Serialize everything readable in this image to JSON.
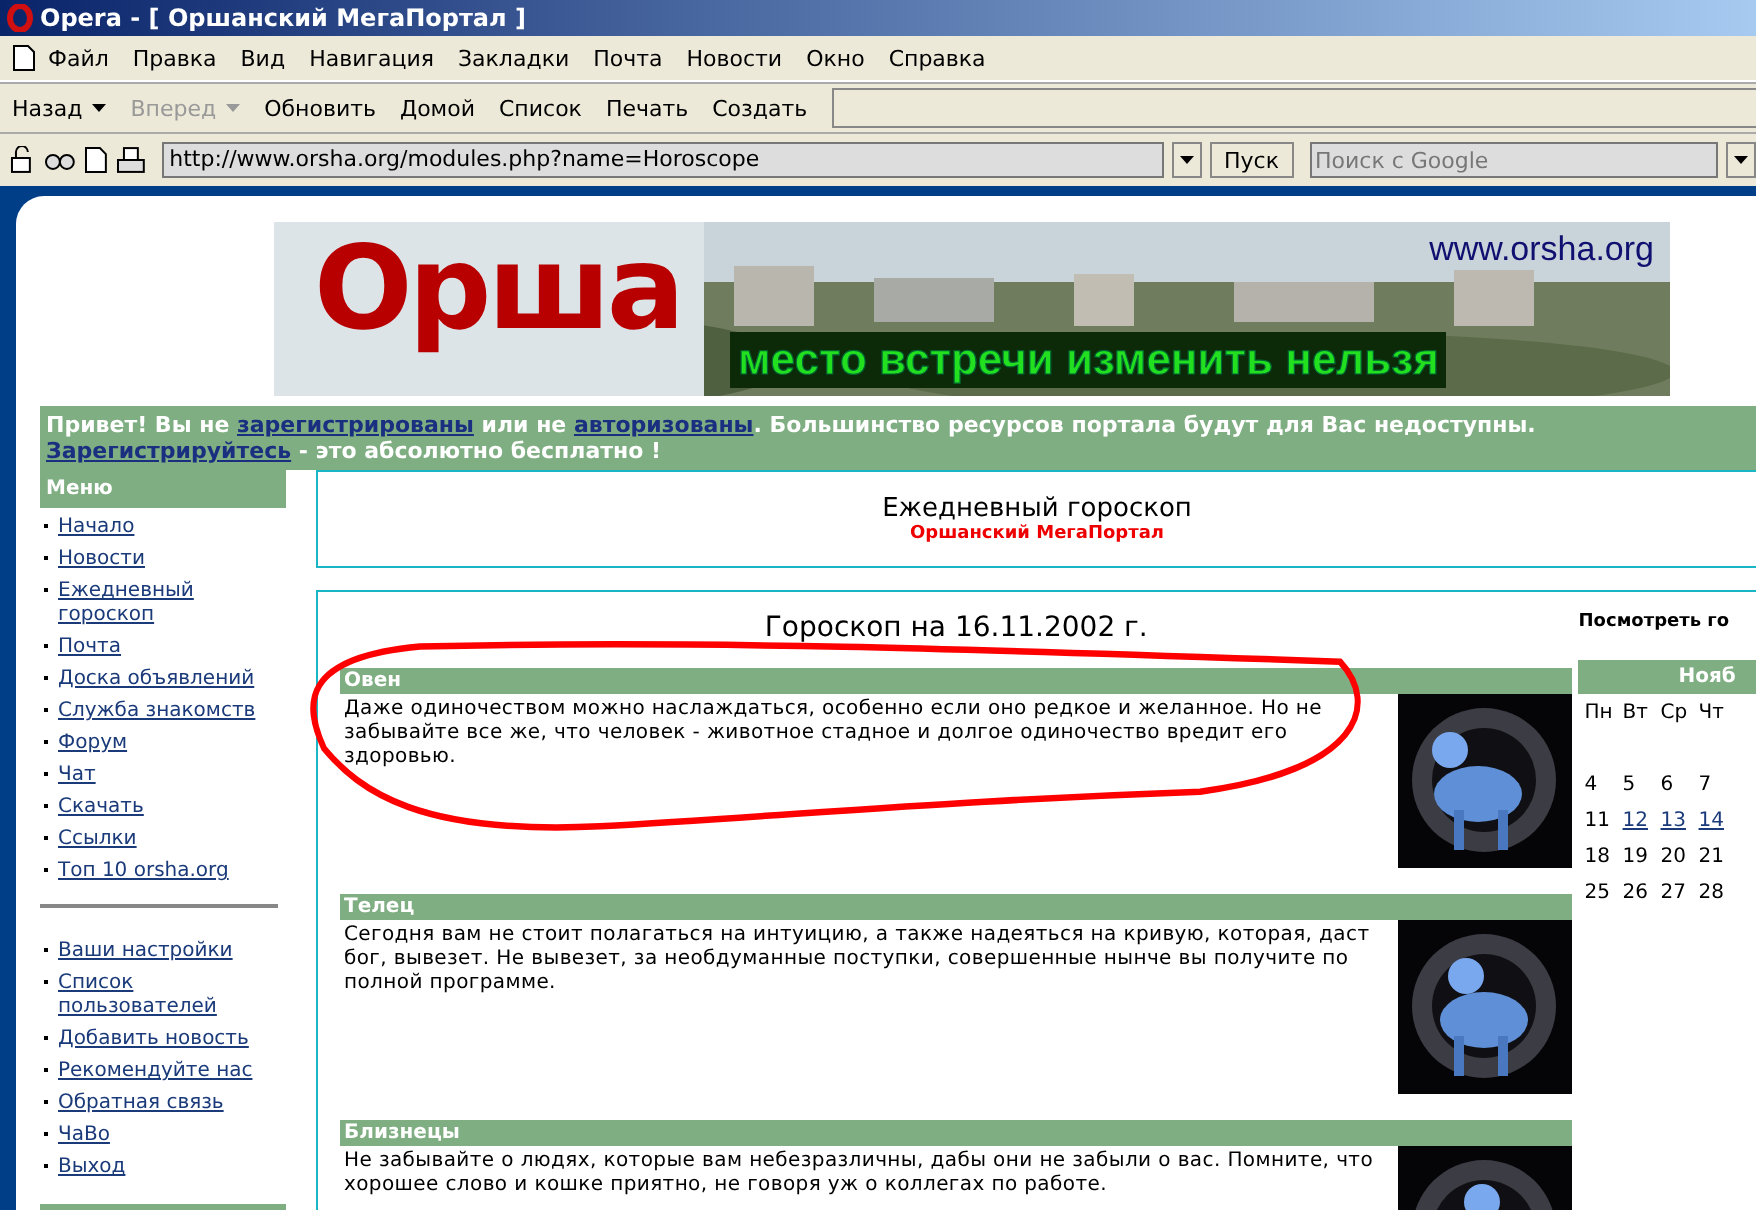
{
  "window": {
    "title": "Opera - [ Оршанский МегаПортал ]"
  },
  "menu_bar": [
    "Файл",
    "Правка",
    "Вид",
    "Навигация",
    "Закладки",
    "Почта",
    "Новости",
    "Окно",
    "Справка"
  ],
  "toolbar": [
    {
      "label": "Назад",
      "dropdown": true,
      "disabled": false
    },
    {
      "label": "Вперед",
      "dropdown": true,
      "disabled": true
    },
    {
      "label": "Обновить",
      "dropdown": false,
      "disabled": false
    },
    {
      "label": "Домой",
      "dropdown": false,
      "disabled": false
    },
    {
      "label": "Список",
      "dropdown": false,
      "disabled": false
    },
    {
      "label": "Печать",
      "dropdown": false,
      "disabled": false
    },
    {
      "label": "Создать",
      "dropdown": false,
      "disabled": false
    }
  ],
  "address_bar": {
    "url": "http://www.orsha.org/modules.php?name=Horoscope",
    "go_button": "Пуск",
    "search_placeholder": "Поиск с Google"
  },
  "banner": {
    "logo": "Орша",
    "site": "www.orsha.org",
    "slogan": "место встречи изменить нельзя"
  },
  "notice": {
    "lines": [
      [
        {
          "kind": "text",
          "text": "Привет! Вы не "
        },
        {
          "kind": "link",
          "text": "зарегистрированы"
        },
        {
          "kind": "text",
          "text": " или не "
        },
        {
          "kind": "link",
          "text": "авторизованы"
        },
        {
          "kind": "text",
          "text": ". Большинство ресурсов портала будут для Вас недоступны."
        }
      ],
      [
        {
          "kind": "link",
          "text": "Зарегистрируйтесь"
        },
        {
          "kind": "text",
          "text": " - это абсолютно бесплатно !"
        }
      ]
    ]
  },
  "sidebar": {
    "title": "Меню",
    "groups": [
      [
        "Начало",
        "Новости",
        "Ежедневный гороскоп",
        "Почта",
        "Доска объявлений",
        "Служба знакомств",
        "Форум",
        "Чат",
        "Скачать",
        "Ссылки",
        "Топ 10 orsha.org"
      ],
      [
        "Ваши настройки",
        "Список пользователей",
        "Добавить новость",
        "Рекомендуйте нас",
        "Обратная связь",
        "ЧаВо",
        "Выход"
      ]
    ]
  },
  "content_header": {
    "title": "Ежедневный гороскоп",
    "subtitle": "Оршанский МегаПортал"
  },
  "horoscope": {
    "title": "Гороскоп на 16.11.2002 г.",
    "signs": [
      {
        "name": "Овен",
        "text": "Даже одиночеством можно наслаждаться, особенно если оно редкое и желанное. Но не забывайте все же, что человек - животное стадное и долгое одиночество вредит его здоровью."
      },
      {
        "name": "Телец",
        "text": "Сегодня вам не стоит полагаться на интуицию, а также надеяться на кривую, которая, даст бог, вывезет. Не вывезет, за необдуманные поступки, совершенные нынче вы получите по полной программе."
      },
      {
        "name": "Близнецы",
        "text": "Не забывайте о людях, которые вам небезразличны, дабы они не забыли о вас. Помните, что хорошее слово и кошке приятно, не говоря уж о коллегах по работе."
      }
    ]
  },
  "calendar": {
    "title": "Посмотреть го",
    "month": "Нояб",
    "weekdays": [
      "Пн",
      "Вт",
      "Ср",
      "Чт"
    ],
    "weeks": [
      [
        {
          "day": "4",
          "kind": "plain"
        },
        {
          "day": "5",
          "kind": "plain"
        },
        {
          "day": "6",
          "kind": "plain"
        },
        {
          "day": "7",
          "kind": "plain"
        }
      ],
      [
        {
          "day": "11",
          "kind": "plain"
        },
        {
          "day": "12",
          "kind": "link"
        },
        {
          "day": "13",
          "kind": "link"
        },
        {
          "day": "14",
          "kind": "link"
        }
      ],
      [
        {
          "day": "18",
          "kind": "plain"
        },
        {
          "day": "19",
          "kind": "plain"
        },
        {
          "day": "20",
          "kind": "plain"
        },
        {
          "day": "21",
          "kind": "plain"
        }
      ],
      [
        {
          "day": "25",
          "kind": "plain"
        },
        {
          "day": "26",
          "kind": "plain"
        },
        {
          "day": "27",
          "kind": "plain"
        },
        {
          "day": "28",
          "kind": "plain"
        }
      ]
    ]
  }
}
